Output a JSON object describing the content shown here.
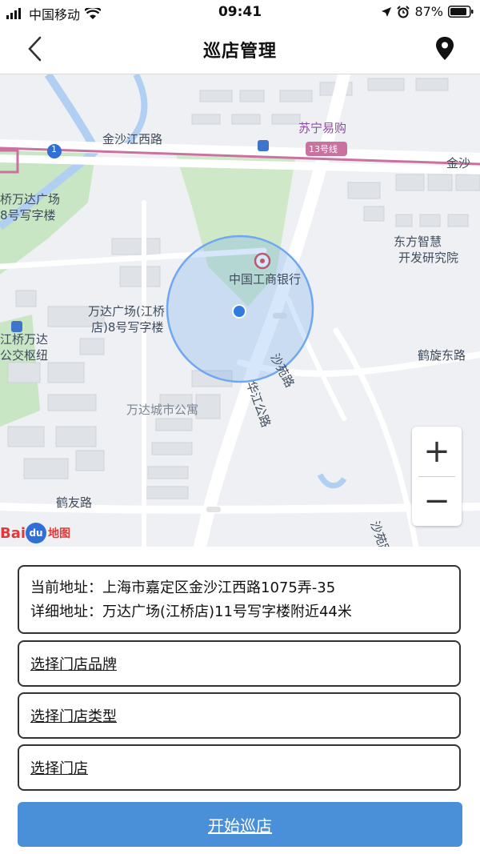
{
  "status_bar": {
    "carrier": "中国移动",
    "time": "09:41",
    "battery": "87%",
    "icons": [
      "signal-icon",
      "wifi-icon",
      "location-arrow-icon",
      "alarm-icon",
      "battery-icon"
    ]
  },
  "nav": {
    "title": "巡店管理",
    "back_icon": "chevron-left-icon",
    "locate_icon": "map-pin-icon"
  },
  "map": {
    "labels": {
      "jinshajiang_west_road": "金沙江西路",
      "suning": "苏宁易购",
      "jinsha_right": "金沙",
      "line13": "13号线",
      "line1": "1",
      "wanda_left_1": "桥万达广场",
      "wanda_left_2": "8号写字楼",
      "dongfang_1": "东方智慧",
      "dongfang_2": "开发研究院",
      "icbc": "中国工商银行",
      "wanda_plaza_1": "万达广场(江桥",
      "wanda_plaza_2": "店)8号写字楼",
      "jiangqiao_1": "江桥万达",
      "jiangqiao_2": "公交枢纽",
      "shayuan_road_1": "沙苑路",
      "huajiang_road": "华江公路",
      "hexuan_east_road": "鹤旋东路",
      "wanda_apartment": "万达城市公寓",
      "heyou_road": "鹤友路",
      "shayuan_road_2": "沙苑路",
      "baidu": "Bai",
      "baidu_du": "du",
      "baidu_map": "地图"
    },
    "zoom_in": "+",
    "zoom_out": "−"
  },
  "address": {
    "current_label": "当前地址：",
    "current_value": "上海市嘉定区金沙江西路1075弄-35",
    "detail_label": "详细地址：",
    "detail_value": "万达广场(江桥店)11号写字楼附近44米"
  },
  "selects": {
    "brand": "选择门店品牌",
    "type": "选择门店类型",
    "store": "选择门店"
  },
  "start_button": "开始巡店",
  "colors": {
    "primary": "#4a90d9",
    "map_bg": "#eef0f3",
    "accuracy_circle": "#6fa8f0"
  }
}
